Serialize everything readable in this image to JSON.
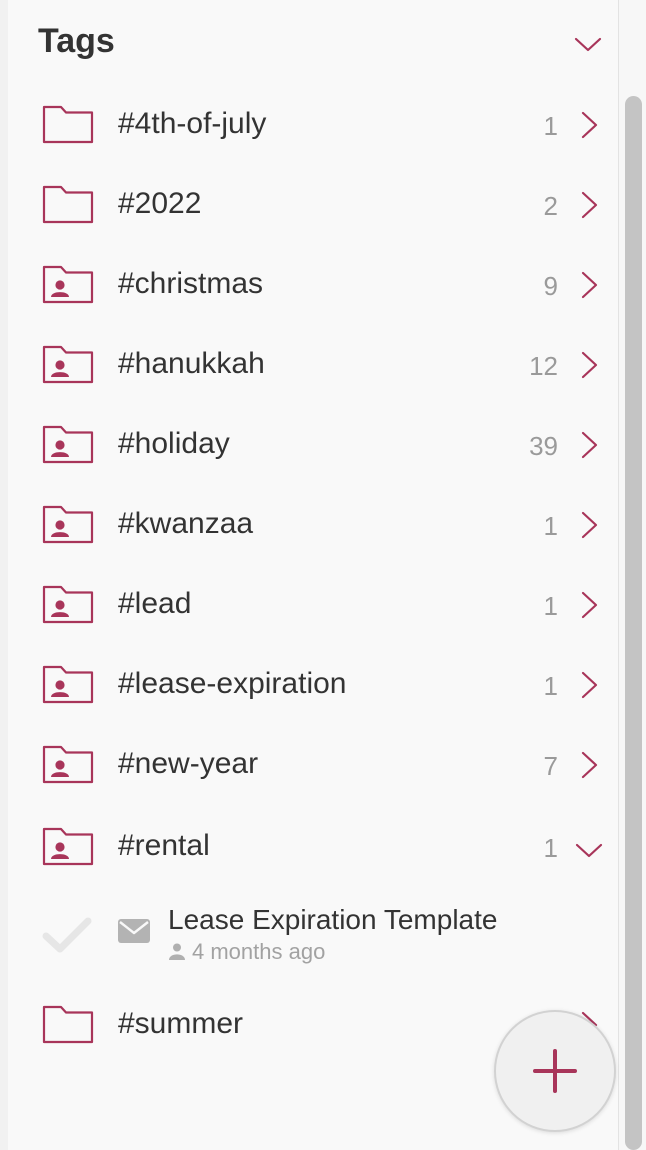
{
  "header": {
    "title": "Tags",
    "collapse_icon": "chevron-down-icon"
  },
  "colors": {
    "accent": "#a8355a",
    "text": "#333333",
    "muted": "#9a9a9a",
    "check": "#e6e6e6",
    "mail": "#b3b3b3"
  },
  "tags": [
    {
      "label": "#4th-of-july",
      "count": "1",
      "icon": "folder-icon",
      "state": "collapsed"
    },
    {
      "label": "#2022",
      "count": "2",
      "icon": "folder-icon",
      "state": "collapsed"
    },
    {
      "label": "#christmas",
      "count": "9",
      "icon": "shared-folder-icon",
      "state": "collapsed"
    },
    {
      "label": "#hanukkah",
      "count": "12",
      "icon": "shared-folder-icon",
      "state": "collapsed"
    },
    {
      "label": "#holiday",
      "count": "39",
      "icon": "shared-folder-icon",
      "state": "collapsed"
    },
    {
      "label": "#kwanzaa",
      "count": "1",
      "icon": "shared-folder-icon",
      "state": "collapsed"
    },
    {
      "label": "#lead",
      "count": "1",
      "icon": "shared-folder-icon",
      "state": "collapsed"
    },
    {
      "label": "#lease-expiration",
      "count": "1",
      "icon": "shared-folder-icon",
      "state": "collapsed"
    },
    {
      "label": "#new-year",
      "count": "7",
      "icon": "shared-folder-icon",
      "state": "collapsed"
    },
    {
      "label": "#rental",
      "count": "1",
      "icon": "shared-folder-icon",
      "state": "expanded"
    },
    {
      "label": "#summer",
      "count": "",
      "icon": "folder-icon",
      "state": "collapsed"
    }
  ],
  "template": {
    "title": "Lease Expiration Template",
    "meta": "4 months ago",
    "icon": "mail-icon",
    "status_icon": "check-icon",
    "meta_icon": "person-icon"
  },
  "fab": {
    "icon": "plus-icon"
  }
}
